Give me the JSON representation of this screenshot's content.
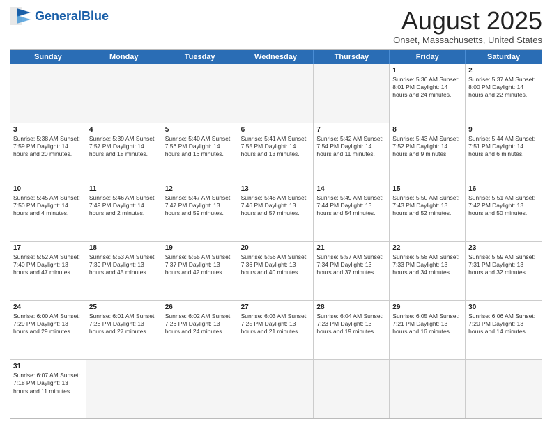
{
  "header": {
    "logo_general": "General",
    "logo_blue": "Blue",
    "title": "August 2025",
    "subtitle": "Onset, Massachusetts, United States"
  },
  "days_of_week": [
    "Sunday",
    "Monday",
    "Tuesday",
    "Wednesday",
    "Thursday",
    "Friday",
    "Saturday"
  ],
  "weeks": [
    {
      "cells": [
        {
          "day": "",
          "empty": true
        },
        {
          "day": "",
          "empty": true
        },
        {
          "day": "",
          "empty": true
        },
        {
          "day": "",
          "empty": true
        },
        {
          "day": "",
          "empty": true
        },
        {
          "day": "1",
          "info": "Sunrise: 5:36 AM\nSunset: 8:01 PM\nDaylight: 14 hours\nand 24 minutes."
        },
        {
          "day": "2",
          "info": "Sunrise: 5:37 AM\nSunset: 8:00 PM\nDaylight: 14 hours\nand 22 minutes."
        }
      ]
    },
    {
      "cells": [
        {
          "day": "3",
          "info": "Sunrise: 5:38 AM\nSunset: 7:59 PM\nDaylight: 14 hours\nand 20 minutes."
        },
        {
          "day": "4",
          "info": "Sunrise: 5:39 AM\nSunset: 7:57 PM\nDaylight: 14 hours\nand 18 minutes."
        },
        {
          "day": "5",
          "info": "Sunrise: 5:40 AM\nSunset: 7:56 PM\nDaylight: 14 hours\nand 16 minutes."
        },
        {
          "day": "6",
          "info": "Sunrise: 5:41 AM\nSunset: 7:55 PM\nDaylight: 14 hours\nand 13 minutes."
        },
        {
          "day": "7",
          "info": "Sunrise: 5:42 AM\nSunset: 7:54 PM\nDaylight: 14 hours\nand 11 minutes."
        },
        {
          "day": "8",
          "info": "Sunrise: 5:43 AM\nSunset: 7:52 PM\nDaylight: 14 hours\nand 9 minutes."
        },
        {
          "day": "9",
          "info": "Sunrise: 5:44 AM\nSunset: 7:51 PM\nDaylight: 14 hours\nand 6 minutes."
        }
      ]
    },
    {
      "cells": [
        {
          "day": "10",
          "info": "Sunrise: 5:45 AM\nSunset: 7:50 PM\nDaylight: 14 hours\nand 4 minutes."
        },
        {
          "day": "11",
          "info": "Sunrise: 5:46 AM\nSunset: 7:49 PM\nDaylight: 14 hours\nand 2 minutes."
        },
        {
          "day": "12",
          "info": "Sunrise: 5:47 AM\nSunset: 7:47 PM\nDaylight: 13 hours\nand 59 minutes."
        },
        {
          "day": "13",
          "info": "Sunrise: 5:48 AM\nSunset: 7:46 PM\nDaylight: 13 hours\nand 57 minutes."
        },
        {
          "day": "14",
          "info": "Sunrise: 5:49 AM\nSunset: 7:44 PM\nDaylight: 13 hours\nand 54 minutes."
        },
        {
          "day": "15",
          "info": "Sunrise: 5:50 AM\nSunset: 7:43 PM\nDaylight: 13 hours\nand 52 minutes."
        },
        {
          "day": "16",
          "info": "Sunrise: 5:51 AM\nSunset: 7:42 PM\nDaylight: 13 hours\nand 50 minutes."
        }
      ]
    },
    {
      "cells": [
        {
          "day": "17",
          "info": "Sunrise: 5:52 AM\nSunset: 7:40 PM\nDaylight: 13 hours\nand 47 minutes."
        },
        {
          "day": "18",
          "info": "Sunrise: 5:53 AM\nSunset: 7:39 PM\nDaylight: 13 hours\nand 45 minutes."
        },
        {
          "day": "19",
          "info": "Sunrise: 5:55 AM\nSunset: 7:37 PM\nDaylight: 13 hours\nand 42 minutes."
        },
        {
          "day": "20",
          "info": "Sunrise: 5:56 AM\nSunset: 7:36 PM\nDaylight: 13 hours\nand 40 minutes."
        },
        {
          "day": "21",
          "info": "Sunrise: 5:57 AM\nSunset: 7:34 PM\nDaylight: 13 hours\nand 37 minutes."
        },
        {
          "day": "22",
          "info": "Sunrise: 5:58 AM\nSunset: 7:33 PM\nDaylight: 13 hours\nand 34 minutes."
        },
        {
          "day": "23",
          "info": "Sunrise: 5:59 AM\nSunset: 7:31 PM\nDaylight: 13 hours\nand 32 minutes."
        }
      ]
    },
    {
      "cells": [
        {
          "day": "24",
          "info": "Sunrise: 6:00 AM\nSunset: 7:29 PM\nDaylight: 13 hours\nand 29 minutes."
        },
        {
          "day": "25",
          "info": "Sunrise: 6:01 AM\nSunset: 7:28 PM\nDaylight: 13 hours\nand 27 minutes."
        },
        {
          "day": "26",
          "info": "Sunrise: 6:02 AM\nSunset: 7:26 PM\nDaylight: 13 hours\nand 24 minutes."
        },
        {
          "day": "27",
          "info": "Sunrise: 6:03 AM\nSunset: 7:25 PM\nDaylight: 13 hours\nand 21 minutes."
        },
        {
          "day": "28",
          "info": "Sunrise: 6:04 AM\nSunset: 7:23 PM\nDaylight: 13 hours\nand 19 minutes."
        },
        {
          "day": "29",
          "info": "Sunrise: 6:05 AM\nSunset: 7:21 PM\nDaylight: 13 hours\nand 16 minutes."
        },
        {
          "day": "30",
          "info": "Sunrise: 6:06 AM\nSunset: 7:20 PM\nDaylight: 13 hours\nand 14 minutes."
        }
      ]
    },
    {
      "cells": [
        {
          "day": "31",
          "info": "Sunrise: 6:07 AM\nSunset: 7:18 PM\nDaylight: 13 hours\nand 11 minutes."
        },
        {
          "day": "",
          "empty": true
        },
        {
          "day": "",
          "empty": true
        },
        {
          "day": "",
          "empty": true
        },
        {
          "day": "",
          "empty": true
        },
        {
          "day": "",
          "empty": true
        },
        {
          "day": "",
          "empty": true
        }
      ]
    }
  ]
}
